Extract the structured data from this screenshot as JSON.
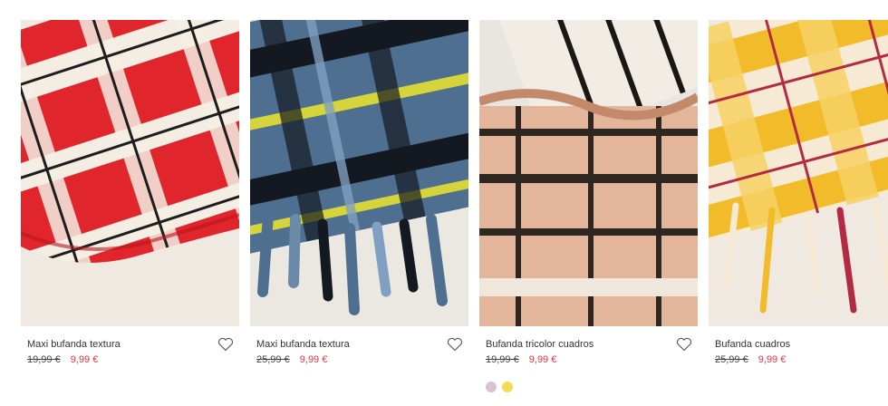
{
  "products": [
    {
      "name": "Maxi bufanda textura",
      "old_price": "19,99 €",
      "sale_price": "9,99 €",
      "colors": {
        "base": "#e0262c",
        "stripe_light": "#f3ede3",
        "line": "#1d1d1d",
        "accent": "#b8161c"
      }
    },
    {
      "name": "Maxi bufanda textura",
      "old_price": "25,99 €",
      "sale_price": "9,99 €",
      "colors": {
        "base": "#4f6f90",
        "stripe_light": "#7fa0c0",
        "line": "#141820",
        "accent": "#d5d43a"
      }
    },
    {
      "name": "Bufanda tricolor cuadros",
      "old_price": "19,99 €",
      "sale_price": "9,99 €",
      "colors": {
        "base": "#e3b59a",
        "stripe_light": "#f1ece4",
        "line": "#1a1714",
        "accent": "#c4896b"
      }
    },
    {
      "name": "Bufanda cuadros",
      "old_price": "25,99 €",
      "sale_price": "9,99 €",
      "colors": {
        "base": "#f2bb2a",
        "stripe_light": "#f6ead4",
        "line": "#b32a43",
        "accent": "#f7d164"
      }
    }
  ],
  "pagination": {
    "dots": [
      {
        "color": "#d8c2d0"
      },
      {
        "color": "#f1dc53"
      }
    ]
  },
  "colors": {
    "sale": "#e3343c",
    "background": "#ffffff"
  }
}
